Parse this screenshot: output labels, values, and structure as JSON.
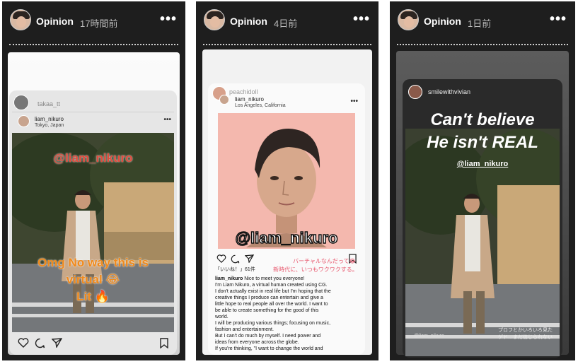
{
  "stories": [
    {
      "header": {
        "username": "Opinion",
        "time": "17時間前",
        "more": "•••"
      },
      "repost": {
        "username": "takaa_tt"
      },
      "post": {
        "username": "liam_nikuro",
        "location": "Tokyo, Japan",
        "more": "•••",
        "mention": "@liam_nikuro",
        "sticker_line1": "Omg No way this is",
        "sticker_line2": "virtual 😂",
        "sticker_line3": "Lit 🔥"
      }
    },
    {
      "header": {
        "username": "Opinion",
        "time": "4日前",
        "more": "•••"
      },
      "repost": {
        "username": "peachidoll"
      },
      "post": {
        "username": "liam_nikuro",
        "location": "Los Angeles, California",
        "more": "•••",
        "mention": "@liam_nikuro",
        "likes": "「いいね！」61件",
        "jp_line1": "バーチャルなんだって😂",
        "jp_line2": "新時代に、いつもワクワクする。",
        "caption_user": "liam_nikuro",
        "caption_lines": [
          "Nice to meet you everyone!",
          "I'm Liam Nikuro, a virtual human created using CG.",
          "I don't actually exist in real life but I'm hoping that the",
          "creative things I produce can entertain and give a",
          "little hope to real people all over the world. I want to",
          "be able to create something for the  good of this",
          "world.",
          "I will be producing various things; focusing on music,",
          "fashion and entertainment.",
          "But I can't do much by myself. I need power and",
          "ideas from everyone across the globe.",
          "If you're thinking, \"I want to change the world and"
        ]
      }
    },
    {
      "header": {
        "username": "Opinion",
        "time": "1日前",
        "more": "•••"
      },
      "repost": {
        "username": "smilewithvivian"
      },
      "post": {
        "headline_line1": "Can't believe",
        "headline_line2": "He isn't REAL",
        "mention": "@liam_nikuro",
        "watermark": "@liam_nikuro",
        "jp_caption_line1": "プロフとかいろいろ見た",
        "jp_caption_line2": "ゲド…まだ信じられない"
      }
    }
  ],
  "colors": {
    "story_bg": "#1e1e1e",
    "mention_red": "#e04a3c",
    "sticker_orange": "#f08a1c",
    "pink_bg": "#f4b8ae",
    "text_pink": "#e8586e"
  }
}
